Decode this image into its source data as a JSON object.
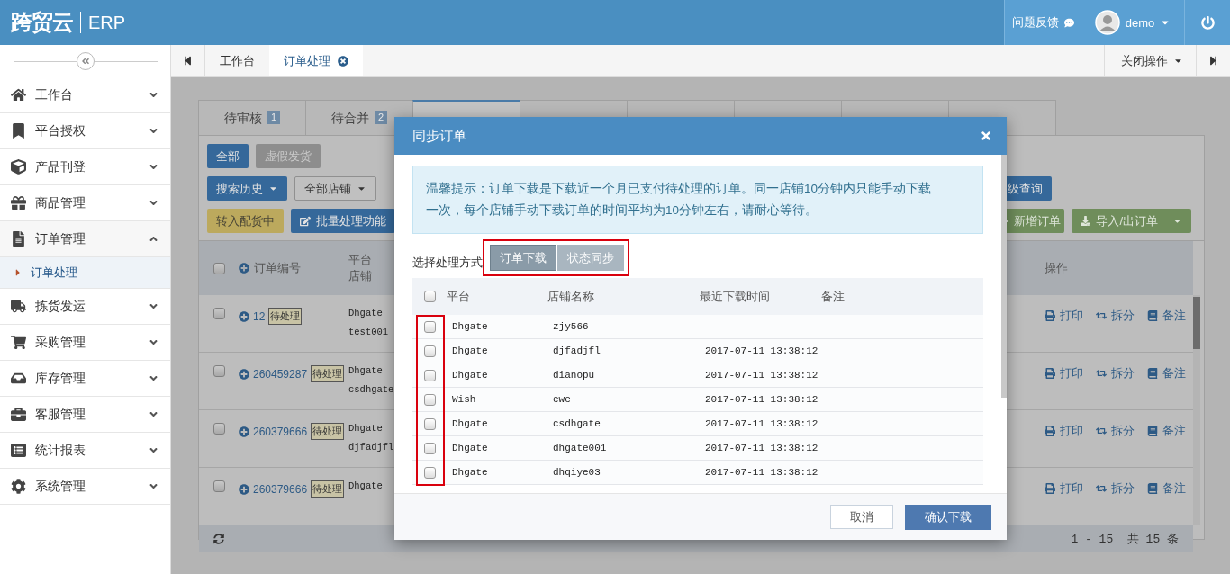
{
  "header": {
    "logo": "跨贸云",
    "product": "ERP",
    "feedback": "问题反馈",
    "user": "demo"
  },
  "page_tabs": {
    "items": [
      {
        "label": "工作台",
        "selected": false,
        "closable": false
      },
      {
        "label": "订单处理",
        "selected": true,
        "closable": true
      }
    ],
    "close_menu": "关闭操作"
  },
  "sidebar": {
    "items": [
      {
        "label": "工作台",
        "expanded": false
      },
      {
        "label": "平台授权",
        "expanded": false
      },
      {
        "label": "产品刊登",
        "expanded": false
      },
      {
        "label": "商品管理",
        "expanded": false
      },
      {
        "label": "订单管理",
        "expanded": true,
        "children": [
          {
            "label": "订单处理",
            "selected": true
          }
        ]
      },
      {
        "label": "拣货发运",
        "expanded": false
      },
      {
        "label": "采购管理",
        "expanded": false
      },
      {
        "label": "库存管理",
        "expanded": false
      },
      {
        "label": "客服管理",
        "expanded": false
      },
      {
        "label": "统计报表",
        "expanded": false
      },
      {
        "label": "系统管理",
        "expanded": false
      }
    ]
  },
  "status_tabs": [
    {
      "label": "待审核",
      "count": "1",
      "selected": false
    },
    {
      "label": "待合并",
      "count": "2",
      "selected": false
    },
    {
      "selected": true
    },
    {
      "selected": false
    },
    {
      "selected": false
    },
    {
      "selected": false
    },
    {
      "selected": false
    },
    {
      "selected": false
    }
  ],
  "filter_buttons": [
    {
      "label": "全部",
      "selected": true
    },
    {
      "label": "虚假发货",
      "selected": false
    }
  ],
  "search_history": "搜索历史",
  "store_select": "全部店铺",
  "advanced_search": "级查询",
  "actions": {
    "move": "转入配货中",
    "batch": "批量处理功能",
    "add": "新增订单",
    "import_export": "导入/出订单"
  },
  "orders": {
    "all_checked": false,
    "columns": {
      "order_no": "订单编号",
      "platform": "平台",
      "store": "店铺",
      "actions": "操作"
    },
    "rows": [
      {
        "id": "12",
        "status": "待处理",
        "platform": "Dhgate",
        "store": "test001",
        "checked": false,
        "actions": [
          "打印",
          "拆分",
          "备注"
        ]
      },
      {
        "id": "260459287",
        "status": "待处理",
        "platform": "Dhgate",
        "store": "csdhgate",
        "checked": false,
        "actions": [
          "打印",
          "拆分",
          "备注"
        ]
      },
      {
        "id": "260379666",
        "status": "待处理",
        "platform": "Dhgate",
        "store": "djfadjfl",
        "checked": false,
        "actions": [
          "打印",
          "拆分",
          "备注"
        ]
      },
      {
        "id": "260379666",
        "status": "待处理",
        "platform": "Dhgate",
        "checked": false,
        "actions": [
          "打印",
          "拆分",
          "备注"
        ]
      }
    ],
    "pagination": "1 - 15  共 15 条"
  },
  "dialog": {
    "title": "同步订单",
    "notice": "温馨提示：订单下载是下载近一个月已支付待处理的订单。同一店铺10分钟内只能手动下载一次，每个店铺手动下载订单的时间平均为10分钟左右，请耐心等待。",
    "mode_label": "选择处理方式",
    "all_checked": false,
    "modes": [
      {
        "label": "订单下载",
        "selected": true
      },
      {
        "label": "状态同步",
        "selected": false
      }
    ],
    "columns": [
      "平台",
      "店铺名称",
      "最近下载时间",
      "备注"
    ],
    "rows": [
      {
        "platform": "Dhgate",
        "store": "zjy566",
        "checked": false
      },
      {
        "platform": "Dhgate",
        "store": "djfadjfl",
        "time": "2017-07-11 13:38:12",
        "checked": false
      },
      {
        "platform": "Dhgate",
        "store": "dianopu",
        "time": "2017-07-11 13:38:12",
        "checked": false
      },
      {
        "platform": "Wish",
        "store": "ewe",
        "time": "2017-07-11 13:38:12",
        "checked": false
      },
      {
        "platform": "Dhgate",
        "store": "csdhgate",
        "time": "2017-07-11 13:38:12",
        "checked": false
      },
      {
        "platform": "Dhgate",
        "store": "dhgate001",
        "time": "2017-07-11 13:38:12",
        "checked": false
      },
      {
        "platform": "Dhgate",
        "store": "dhqiye03",
        "time": "2017-07-11 13:38:12",
        "checked": false
      }
    ],
    "cancel": "取消",
    "confirm": "确认下载"
  }
}
